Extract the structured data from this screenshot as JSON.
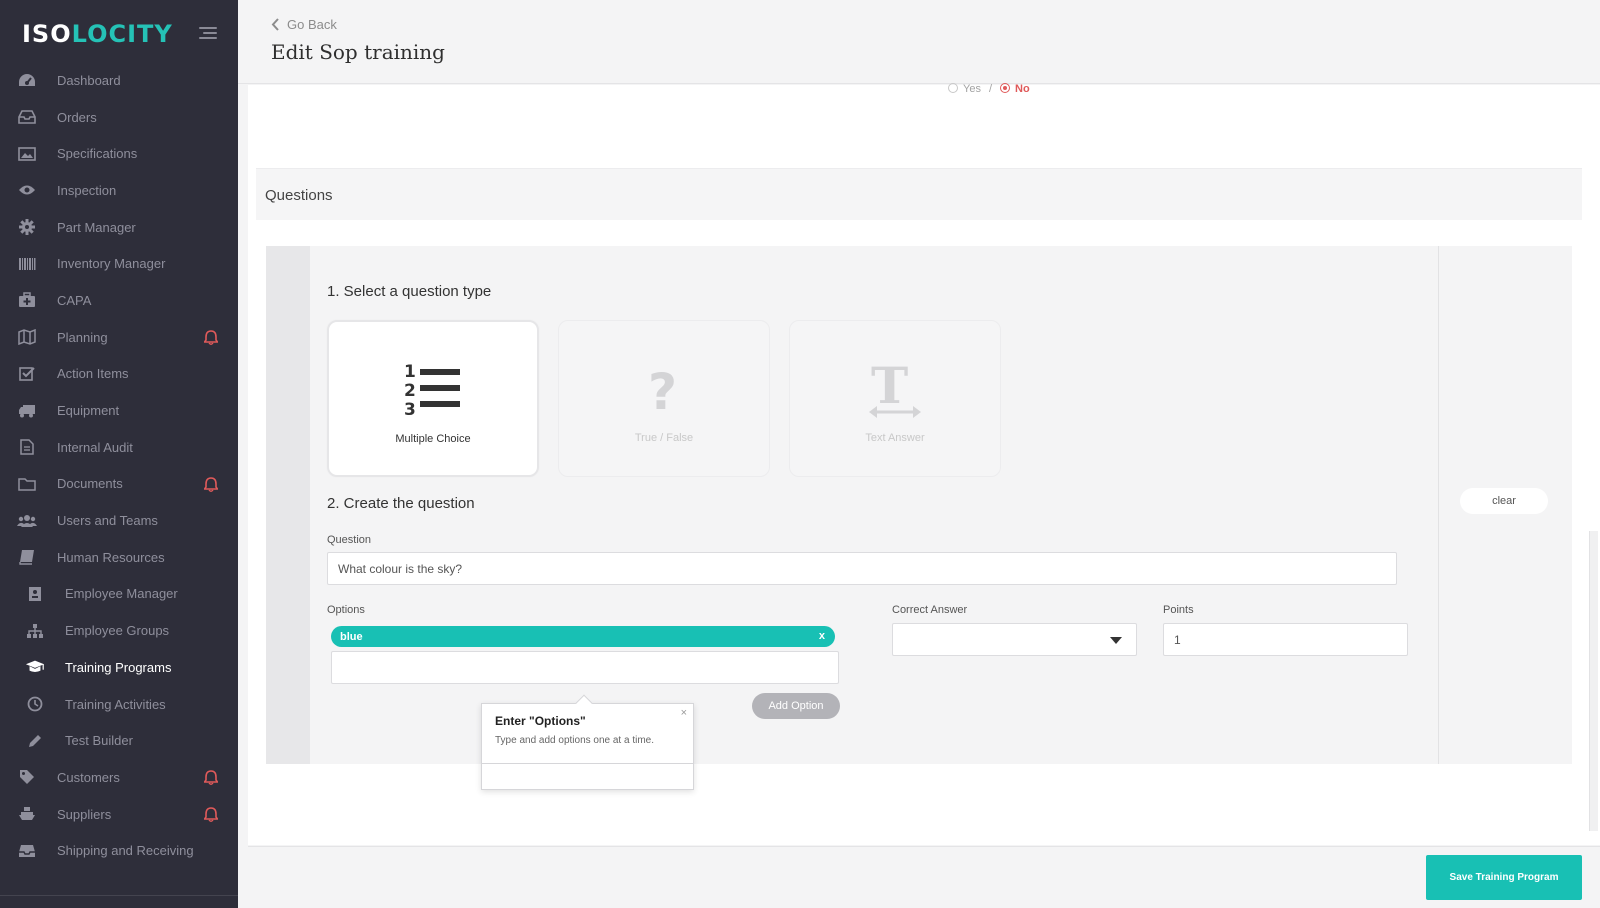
{
  "sidebar": {
    "logo": {
      "part1": "ISO",
      "part2": "LOCITY"
    },
    "items": [
      {
        "label": "Dashboard",
        "icon": "dashboard-icon",
        "alert": false,
        "sub": false
      },
      {
        "label": "Orders",
        "icon": "inbox-icon",
        "alert": false,
        "sub": false
      },
      {
        "label": "Specifications",
        "icon": "image-icon",
        "alert": false,
        "sub": false
      },
      {
        "label": "Inspection",
        "icon": "eye-icon",
        "alert": false,
        "sub": false
      },
      {
        "label": "Part Manager",
        "icon": "gear-icon",
        "alert": false,
        "sub": false
      },
      {
        "label": "Inventory Manager",
        "icon": "barcode-icon",
        "alert": false,
        "sub": false
      },
      {
        "label": "CAPA",
        "icon": "medkit-icon",
        "alert": false,
        "sub": false
      },
      {
        "label": "Planning",
        "icon": "map-icon",
        "alert": true,
        "sub": false
      },
      {
        "label": "Action Items",
        "icon": "checkbox-icon",
        "alert": false,
        "sub": false
      },
      {
        "label": "Equipment",
        "icon": "truck-icon",
        "alert": false,
        "sub": false
      },
      {
        "label": "Internal Audit",
        "icon": "document-icon",
        "alert": false,
        "sub": false
      },
      {
        "label": "Documents",
        "icon": "folder-icon",
        "alert": true,
        "sub": false
      },
      {
        "label": "Users and Teams",
        "icon": "users-icon",
        "alert": false,
        "sub": false
      },
      {
        "label": "Human Resources",
        "icon": "book-icon",
        "alert": false,
        "sub": false
      },
      {
        "label": "Employee Manager",
        "icon": "id-badge-icon",
        "alert": false,
        "sub": true
      },
      {
        "label": "Employee Groups",
        "icon": "sitemap-icon",
        "alert": false,
        "sub": true
      },
      {
        "label": "Training Programs",
        "icon": "graduation-cap-icon",
        "alert": false,
        "sub": true,
        "active": true
      },
      {
        "label": "Training Activities",
        "icon": "clock-icon",
        "alert": false,
        "sub": true
      },
      {
        "label": "Test Builder",
        "icon": "pencil-icon",
        "alert": false,
        "sub": true
      },
      {
        "label": "Customers",
        "icon": "tag-icon",
        "alert": true,
        "sub": false
      },
      {
        "label": "Suppliers",
        "icon": "ship-icon",
        "alert": true,
        "sub": false
      },
      {
        "label": "Shipping and Receiving",
        "icon": "tray-icon",
        "alert": false,
        "sub": false
      }
    ]
  },
  "header": {
    "back_label": "Go Back",
    "title": "Edit Sop training"
  },
  "toggle": {
    "yes": "Yes",
    "sep": "/",
    "no": "No",
    "selected": "No"
  },
  "questions": {
    "section_title": "Questions",
    "step1": "1. Select a question type",
    "types": [
      {
        "label": "Multiple Choice",
        "icon": "list-ordered-icon",
        "selected": true
      },
      {
        "label": "True / False",
        "icon": "question-mark-icon",
        "selected": false
      },
      {
        "label": "Text Answer",
        "icon": "text-width-icon",
        "selected": false
      }
    ],
    "step2": "2. Create the question",
    "question_label": "Question",
    "question_value": "What colour is the sky?",
    "options_label": "Options",
    "options": [
      "blue"
    ],
    "option_input_value": "",
    "add_option": "Add Option",
    "correct_answer_label": "Correct Answer",
    "correct_answer_value": "",
    "points_label": "Points",
    "points_value": "1",
    "clear": "clear"
  },
  "popover": {
    "title": "Enter \"Options\"",
    "body": "Type and add options one at a time.",
    "close": "×"
  },
  "footer": {
    "save": "Save Training Program"
  },
  "colors": {
    "accent": "#18c0b4",
    "sidebar_bg": "#2e2e3a",
    "alert": "#e05a5a"
  }
}
